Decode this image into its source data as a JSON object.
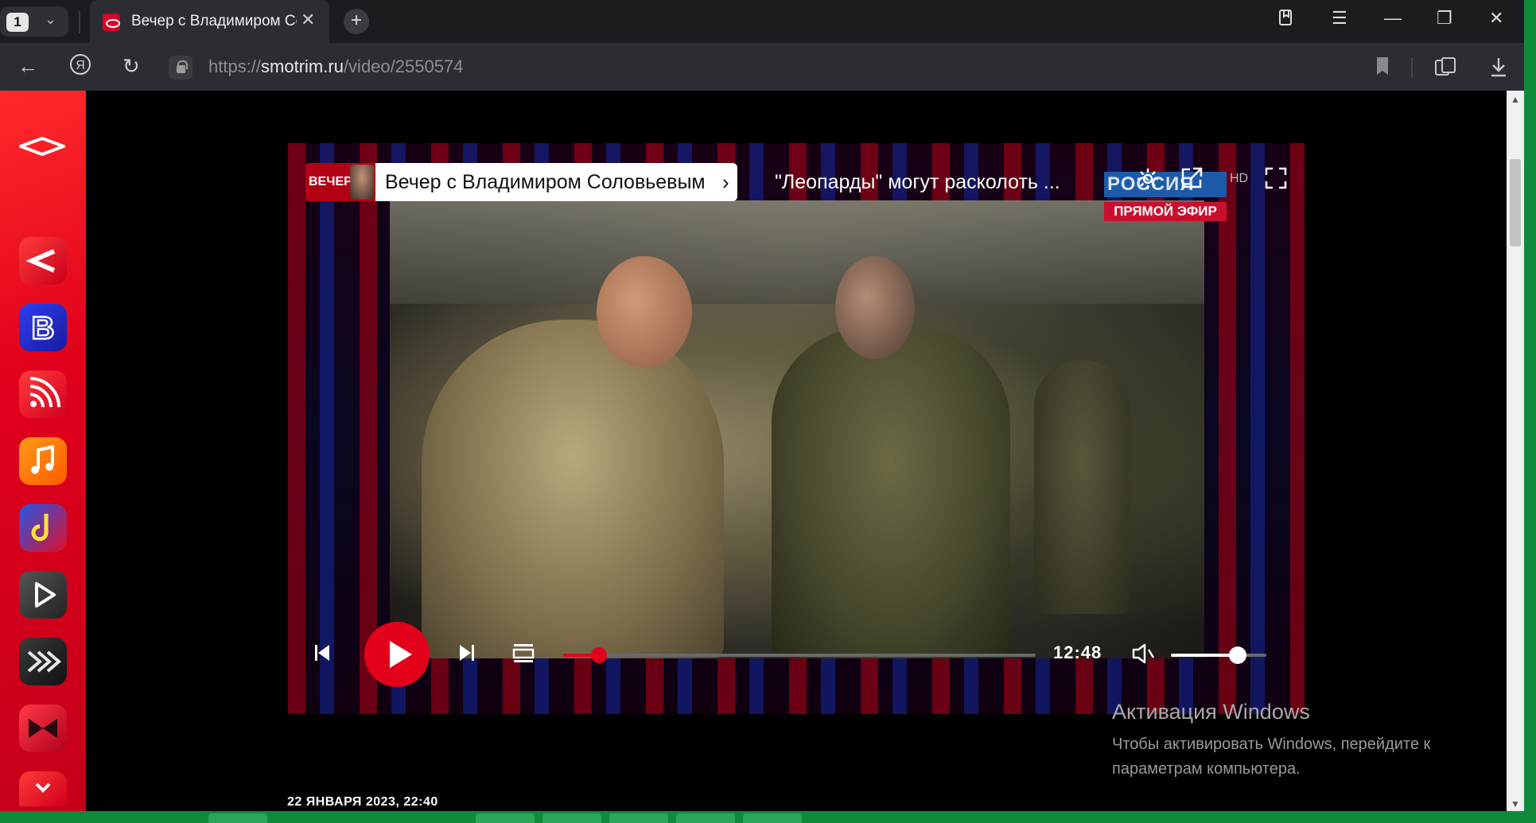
{
  "browser": {
    "tab_count": "1",
    "tab_title": "Вечер с Владимиром Соловьевым",
    "url_scheme": "https://",
    "url_host": "smotrim.ru",
    "url_path": "/video/2550574"
  },
  "player": {
    "show_badge": "ВЕЧЕР",
    "show_title": "Вечер с Владимиром Соловьевым",
    "episode_title": "\"Леопарды\" могут расколоть ...",
    "channel": "РОССИЯ",
    "live_badge": "ПРЯМОЙ ЭФИР",
    "quality": "HD",
    "time_remaining": "12:48",
    "progress_fraction": 0.075,
    "volume_fraction": 0.7
  },
  "page": {
    "date": "22 ЯНВАРЯ 2023, 22:40"
  },
  "windows_activation": {
    "title": "Активация Windows",
    "message": "Чтобы активировать Windows, перейдите к параметрам компьютера."
  },
  "colors": {
    "brand_red": "#e3001b",
    "chrome_dark": "#2c2d33"
  }
}
